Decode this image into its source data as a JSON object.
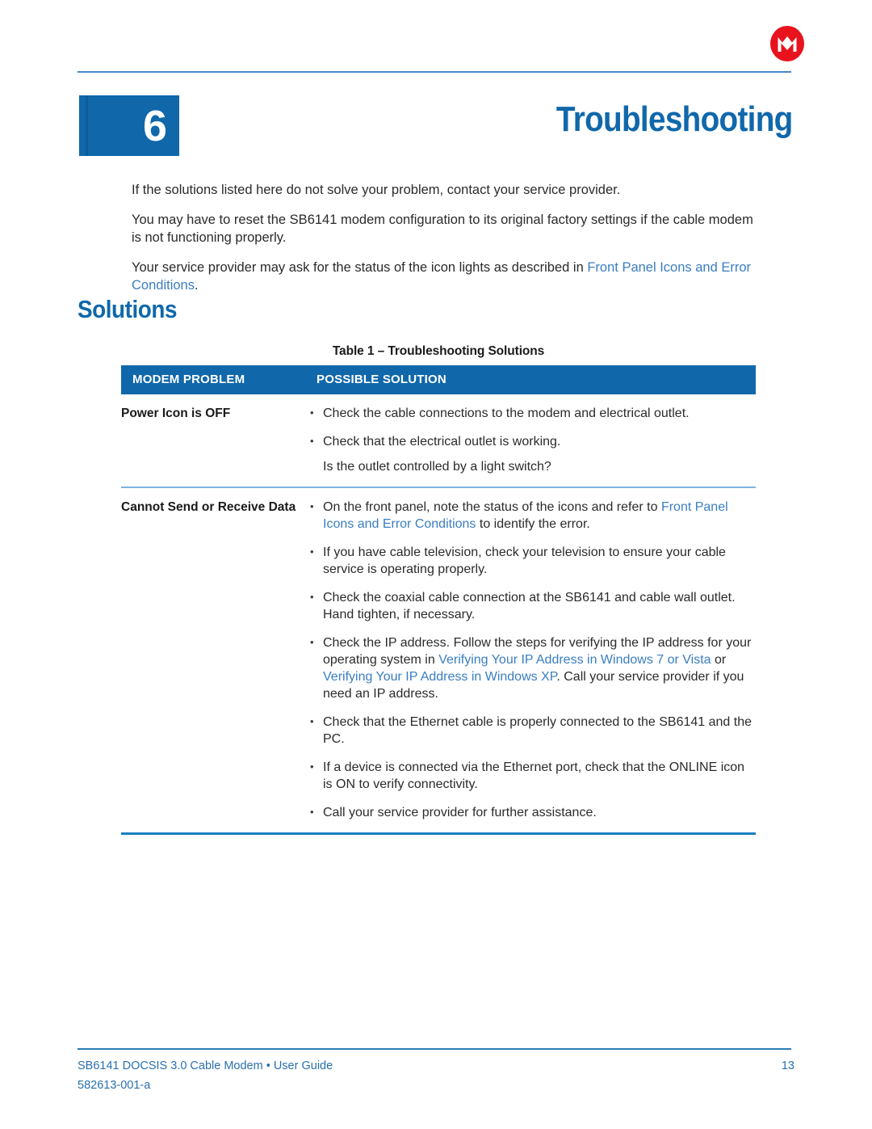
{
  "header": {
    "logo_icon": "motorola-logo-icon",
    "logo_color": "#e8131d",
    "chapter_number": "6",
    "chapter_title": "Troubleshooting",
    "accent_color": "#1068ab"
  },
  "intro": {
    "paragraph_1": "If the solutions listed here do not solve your problem, contact your service provider.",
    "paragraph_2": "You may have to reset the SB6141 modem configuration to its original factory settings if the cable modem is not functioning properly.",
    "paragraph_3_pre": "Your service provider may ask for the status of the icon lights as described in ",
    "paragraph_3_link": "Front Panel Icons and Error Conditions",
    "paragraph_3_post": "."
  },
  "section": {
    "heading": "Solutions"
  },
  "table": {
    "caption": "Table 1 – Troubleshooting Solutions",
    "headers": {
      "problem": "MODEM PROBLEM",
      "solution": "POSSIBLE SOLUTION"
    },
    "rows": [
      {
        "problem": "Power Icon is OFF",
        "solutions": [
          {
            "bulleted": true,
            "segments": [
              {
                "text": "Check the cable connections to the modem and electrical outlet.",
                "link": false
              }
            ]
          },
          {
            "bulleted": true,
            "segments": [
              {
                "text": "Check that the electrical outlet is working.",
                "link": false
              }
            ]
          },
          {
            "bulleted": false,
            "segments": [
              {
                "text": "Is the outlet controlled by a light switch?",
                "link": false
              }
            ]
          }
        ]
      },
      {
        "problem": "Cannot Send or Receive Data",
        "solutions": [
          {
            "bulleted": true,
            "segments": [
              {
                "text": "On the front panel, note the status of the icons and refer to ",
                "link": false
              },
              {
                "text": "Front Panel Icons and Error Conditions",
                "link": true
              },
              {
                "text": " to identify the error.",
                "link": false
              }
            ]
          },
          {
            "bulleted": true,
            "segments": [
              {
                "text": "If you have cable television, check your television to ensure your cable service is operating properly.",
                "link": false
              }
            ]
          },
          {
            "bulleted": true,
            "segments": [
              {
                "text": "Check the coaxial cable connection at the SB6141 and cable wall outlet. Hand tighten, if necessary.",
                "link": false
              }
            ]
          },
          {
            "bulleted": true,
            "segments": [
              {
                "text": "Check the IP address. Follow the steps for verifying the IP address for your operating system in ",
                "link": false
              },
              {
                "text": "Verifying Your IP Address in Windows 7 or Vista",
                "link": true
              },
              {
                "text": " or ",
                "link": false
              },
              {
                "text": "Verifying Your IP Address in Windows XP",
                "link": true
              },
              {
                "text": ". Call your service provider if you need an IP address.",
                "link": false
              }
            ]
          },
          {
            "bulleted": true,
            "segments": [
              {
                "text": "Check that the Ethernet cable is properly connected to the SB6141 and the PC.",
                "link": false
              }
            ]
          },
          {
            "bulleted": true,
            "segments": [
              {
                "text": "If a device is connected via the Ethernet port, check that the ONLINE icon is ON to verify connectivity.",
                "link": false
              }
            ]
          },
          {
            "bulleted": true,
            "segments": [
              {
                "text": "Call your service provider for further assistance.",
                "link": false
              }
            ]
          }
        ]
      }
    ]
  },
  "footer": {
    "product_line": "SB6141 DOCSIS 3.0 Cable Modem • User Guide",
    "doc_number": "582613-001-a",
    "page_number": "13"
  }
}
